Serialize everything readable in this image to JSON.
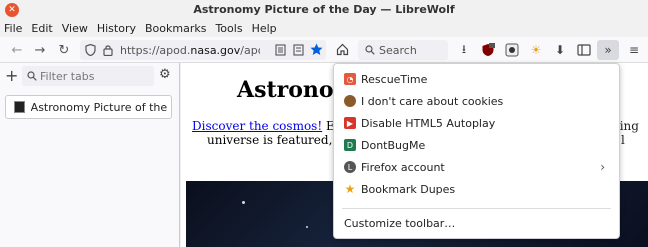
{
  "window": {
    "title": "Astronomy Picture of the Day — LibreWolf"
  },
  "menubar": {
    "items": [
      "File",
      "Edit",
      "View",
      "History",
      "Bookmarks",
      "Tools",
      "Help"
    ]
  },
  "navbar": {
    "url_prefix": "https://apod.",
    "url_domain": "nasa.gov",
    "url_suffix": "/apod/asti",
    "search_placeholder": "Search"
  },
  "sidebar": {
    "filter_placeholder": "Filter tabs",
    "tabs": [
      {
        "label": "Astronomy Picture of the Day"
      }
    ]
  },
  "page": {
    "title": "Astronon",
    "link": "Discover the cosmos!",
    "line1_rest": " Each",
    "line2": "universe is featured, alo",
    "right1": "cing",
    "right2": "l"
  },
  "overflow_menu": {
    "items": [
      {
        "label": "RescueTime",
        "icon": "rescuetime-icon",
        "color": "#e35a3c"
      },
      {
        "label": "I don't care about cookies",
        "icon": "cookie-icon",
        "color": "#8a5a2b"
      },
      {
        "label": "Disable HTML5 Autoplay",
        "icon": "autoplay-icon",
        "color": "#d9342b"
      },
      {
        "label": "DontBugMe",
        "icon": "dontbugme-icon",
        "color": "#1e7a4f"
      },
      {
        "label": "Firefox account",
        "icon": "account-icon",
        "color": "#555555",
        "has_submenu": true
      },
      {
        "label": "Bookmark Dupes",
        "icon": "star-icon",
        "color": "#e8a317"
      }
    ],
    "customize_label": "Customize toolbar…"
  },
  "colors": {
    "close_button": "#e8542d",
    "bookmark_star": "#0060df",
    "link": "#0000ee"
  }
}
